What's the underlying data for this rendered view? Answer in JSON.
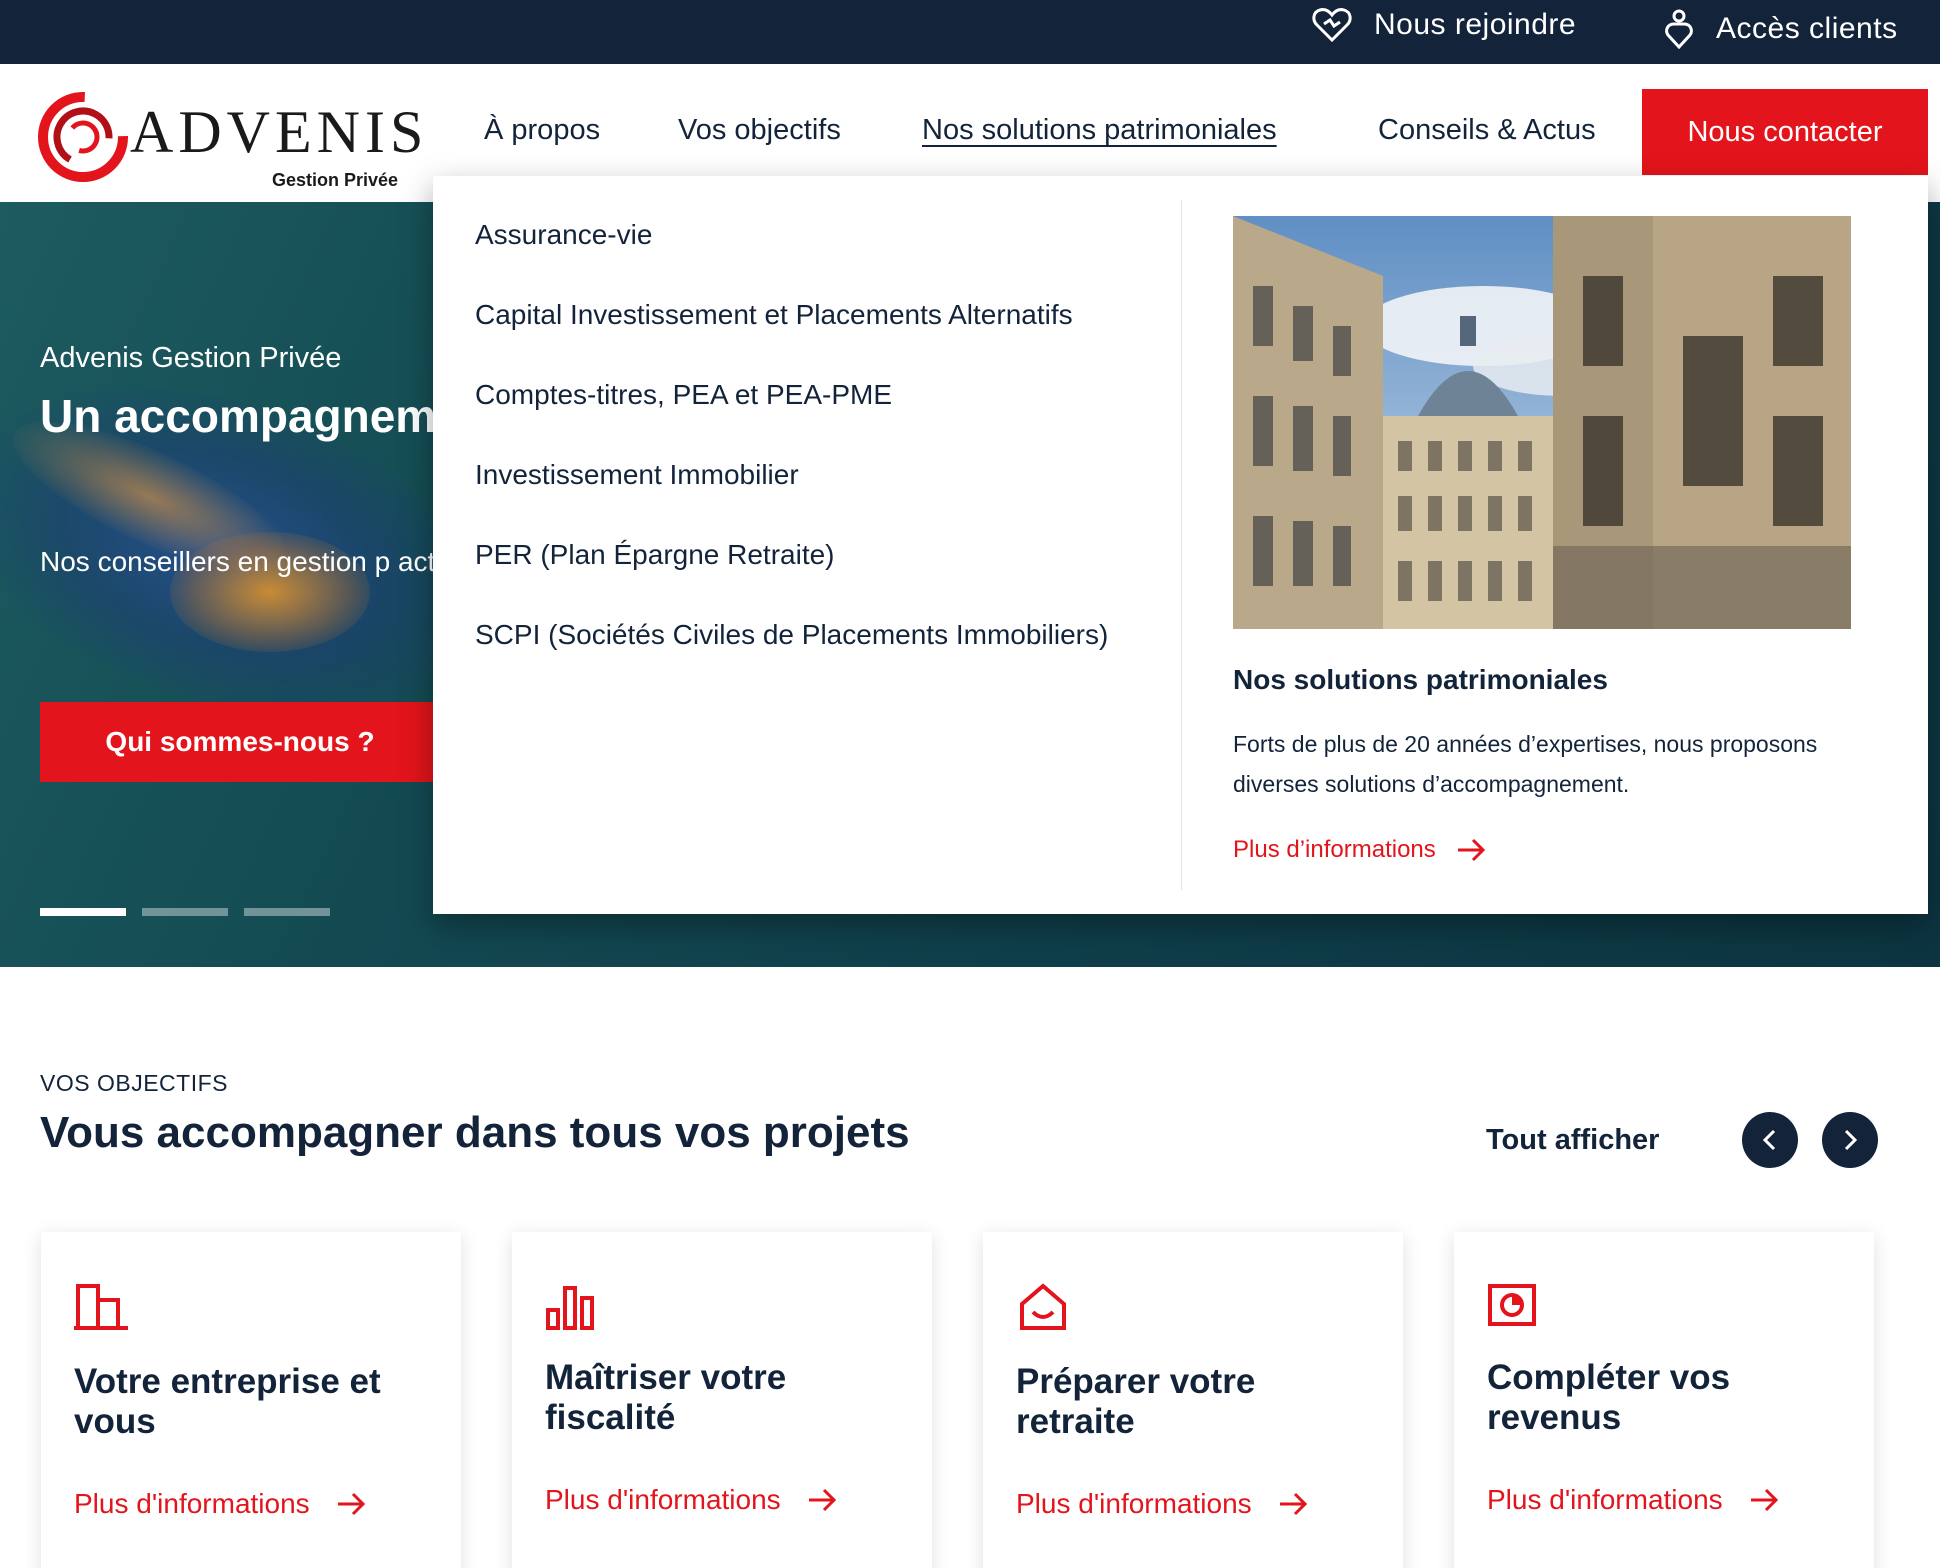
{
  "topbar": {
    "join_label": "Nous rejoindre",
    "join_icon": "heart-icon",
    "client_label": "Accès clients",
    "client_icon": "user-icon"
  },
  "header": {
    "logo_word": "ADVENIS",
    "logo_sub": "Gestion Privée",
    "nav": [
      {
        "label": "À propos"
      },
      {
        "label": "Vos objectifs"
      },
      {
        "label": "Nos solutions patrimoniales"
      },
      {
        "label": "Conseils & Actus"
      }
    ],
    "contact_label": "Nous contacter"
  },
  "hero": {
    "kicker": "Advenis Gestion Privée",
    "title": "Un accompagnement de vos projets pa",
    "text": "Nos conseillers en gestion p actuels et futurs.",
    "button_label": "Qui sommes-nous ?"
  },
  "mega": {
    "links": [
      {
        "label": "Assurance-vie"
      },
      {
        "label": "Capital Investissement et Placements Alternatifs"
      },
      {
        "label": "Comptes-titres, PEA et PEA-PME"
      },
      {
        "label": "Investissement Immobilier"
      },
      {
        "label": "PER (Plan Épargne Retraite)"
      },
      {
        "label": "SCPI (Sociétés Civiles de Placements Immobiliers)"
      }
    ],
    "card_title": "Nos solutions patrimoniales",
    "card_text": "Forts de plus de 20 années d’expertises, nous proposons diverses solutions d’accompagnement.",
    "card_more": "Plus d’informations"
  },
  "objectives": {
    "kicker": "VOS OBJECTIFS",
    "title": "Vous accompagner dans tous vos projets",
    "see_all": "Tout afficher",
    "cards": [
      {
        "title": "Votre entreprise et vous",
        "more": "Plus d'informations",
        "icon": "building-icon"
      },
      {
        "title": "Maîtriser votre fiscalité",
        "more": "Plus d'informations",
        "icon": "bar-chart-icon"
      },
      {
        "title": "Préparer votre retraite",
        "more": "Plus d'informations",
        "icon": "home-smile-icon"
      },
      {
        "title": "Compléter vos revenus",
        "more": "Plus d'informations",
        "icon": "pie-chart-icon"
      }
    ]
  },
  "colors": {
    "navy": "#13243a",
    "red": "#e3141b",
    "teal": "#134a52"
  }
}
